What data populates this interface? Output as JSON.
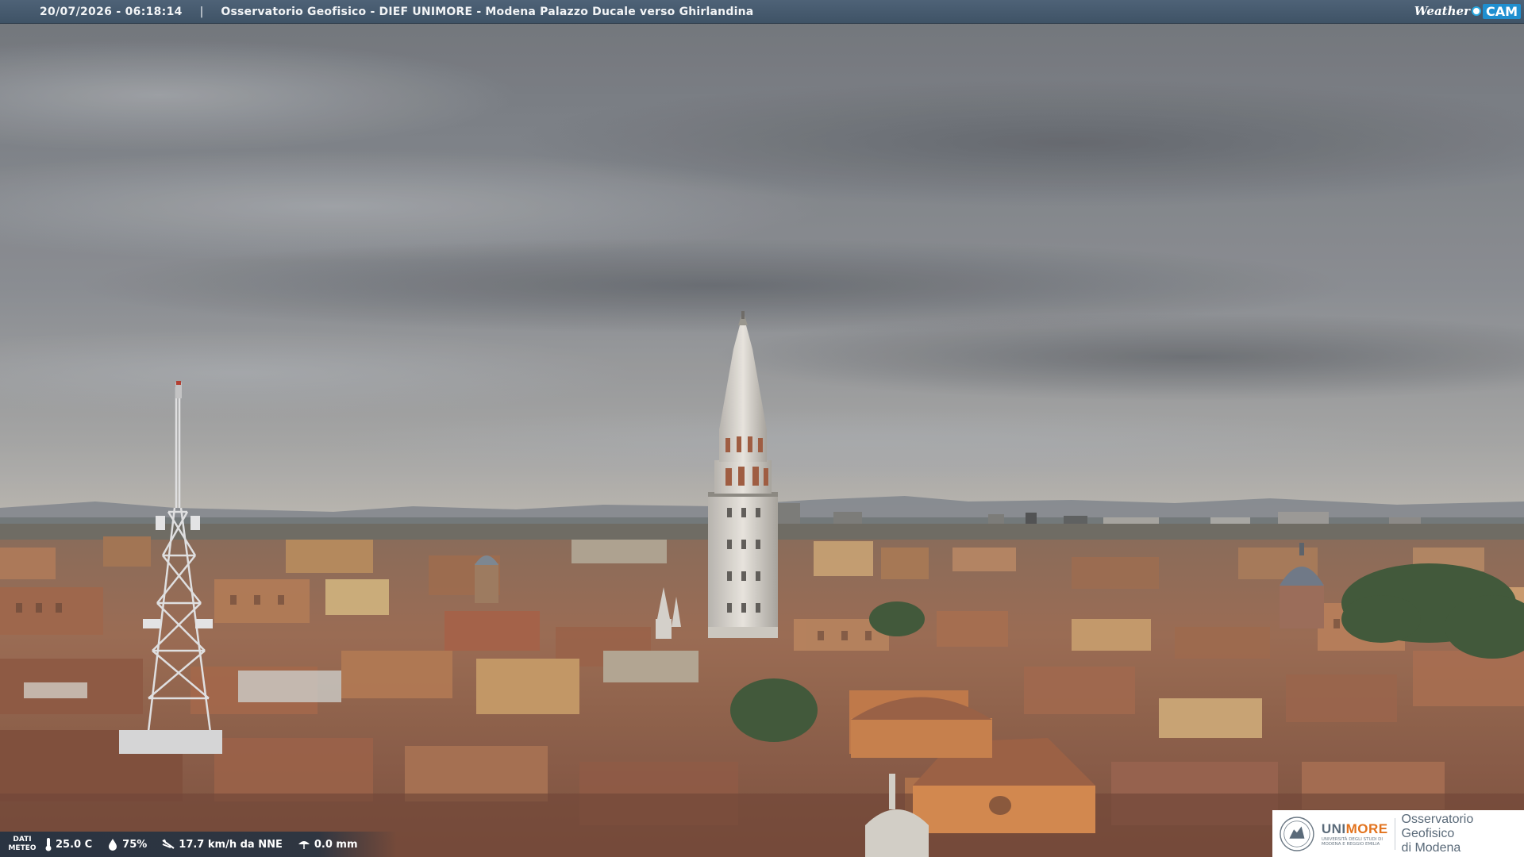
{
  "header": {
    "datetime": "20/07/2026 - 06:18:14",
    "separator": "|",
    "title": "Osservatorio Geofisico - DIEF UNIMORE - Modena Palazzo Ducale verso Ghirlandina"
  },
  "brand": {
    "weather_text": "Weather",
    "cam_text": "CAM",
    "accent_color": "#1f8fd0"
  },
  "meteo": {
    "label_line1": "DATI",
    "label_line2": "METEO",
    "temperature": "25.0 C",
    "humidity": "75%",
    "wind": "17.7 km/h da NNE",
    "rain": "0.0 mm",
    "icons": [
      "thermometer-icon",
      "humidity-drop-icon",
      "wind-icon",
      "rain-icon"
    ]
  },
  "logo": {
    "unimore_pre": "UNI",
    "unimore_accent": "MORE",
    "unimore_sub_line1": "Università degli studi di",
    "unimore_sub_line2": "Modena e Reggio Emilia",
    "observatory_line1": "Osservatorio Geofisico",
    "observatory_line2": "di Modena",
    "accent_color": "#e2731e"
  }
}
